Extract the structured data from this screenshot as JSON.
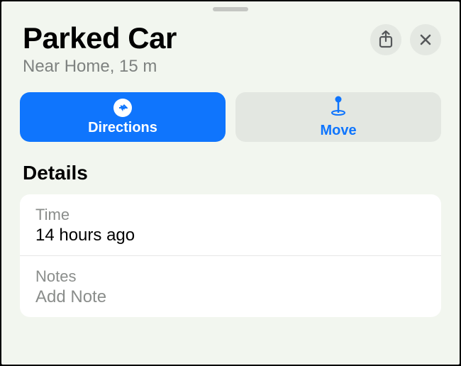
{
  "header": {
    "title": "Parked Car",
    "subtitle": "Near Home, 15 m"
  },
  "actions": {
    "directions_label": "Directions",
    "move_label": "Move"
  },
  "details": {
    "section_title": "Details",
    "time_label": "Time",
    "time_value": "14 hours ago",
    "notes_label": "Notes",
    "notes_placeholder": "Add Note"
  },
  "colors": {
    "accent": "#0f75fd"
  }
}
